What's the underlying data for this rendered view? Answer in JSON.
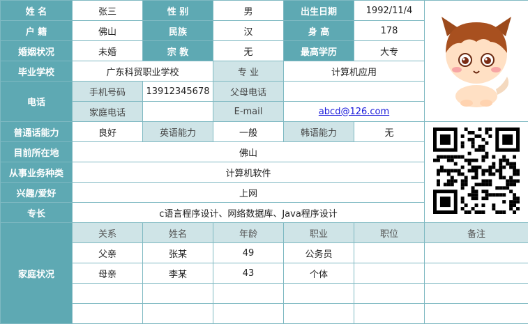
{
  "labels": {
    "name": "姓 名",
    "gender": "性 别",
    "birth": "出生日期",
    "hukou": "户 籍",
    "ethnicity": "民族",
    "height": "身 高",
    "marital": "婚姻状况",
    "religion": "宗 教",
    "education": "最高学历",
    "school": "毕业学校",
    "major": "专 业",
    "phone": "电话",
    "mobile": "手机号码",
    "parent_phone": "父母电话",
    "home_phone": "家庭电话",
    "email": "E-mail",
    "mandarin": "普通话能力",
    "english": "英语能力",
    "korean": "韩语能力",
    "current_location": "目前所在地",
    "job_type": "从事业务种类",
    "hobby": "兴趣/爱好",
    "specialty": "专长",
    "family": "家庭状况"
  },
  "values": {
    "name": "张三",
    "gender": "男",
    "birth": "1992/11/4",
    "hukou": "佛山",
    "ethnicity": "汉",
    "height": "178",
    "marital": "未婚",
    "religion": "无",
    "education": "大专",
    "school": "广东科贸职业学校",
    "major": "计算机应用",
    "mobile": "13912345678",
    "parent_phone": "",
    "home_phone": "",
    "email": "abcd@126.com",
    "mandarin": "良好",
    "english": "一般",
    "korean": "无",
    "current_location": "佛山",
    "job_type": "计算机软件",
    "hobby": "上网",
    "specialty": "c语言程序设计、网络数据库、Java程序设计"
  },
  "family": {
    "headers": [
      "关系",
      "姓名",
      "年龄",
      "职业",
      "职位",
      "备注"
    ],
    "rows": [
      [
        "父亲",
        "张某",
        "49",
        "公务员",
        "",
        ""
      ],
      [
        "母亲",
        "李某",
        "43",
        "个体",
        "",
        ""
      ],
      [
        "",
        "",
        "",
        "",
        "",
        ""
      ],
      [
        "",
        "",
        "",
        "",
        "",
        ""
      ]
    ]
  },
  "colors": {
    "header_bg": "#5ea9b3",
    "sub_bg": "#cfe4e7",
    "border": "#7fb9c2",
    "link": "#1a1adb"
  },
  "images": {
    "photo": "cartoon-boy-avatar",
    "qr": "qr-code"
  }
}
